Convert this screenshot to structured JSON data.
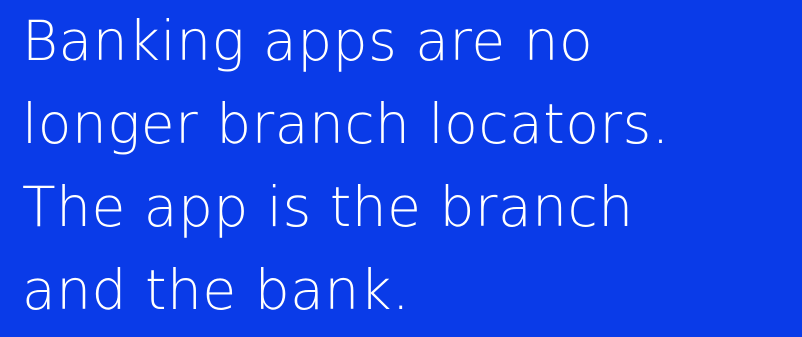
{
  "headline": {
    "lines": [
      "Banking apps are no",
      "longer branch locators.",
      "The app is the branch",
      "and the bank."
    ]
  },
  "colors": {
    "background": "#0a3be8",
    "text": "#ffffff"
  }
}
